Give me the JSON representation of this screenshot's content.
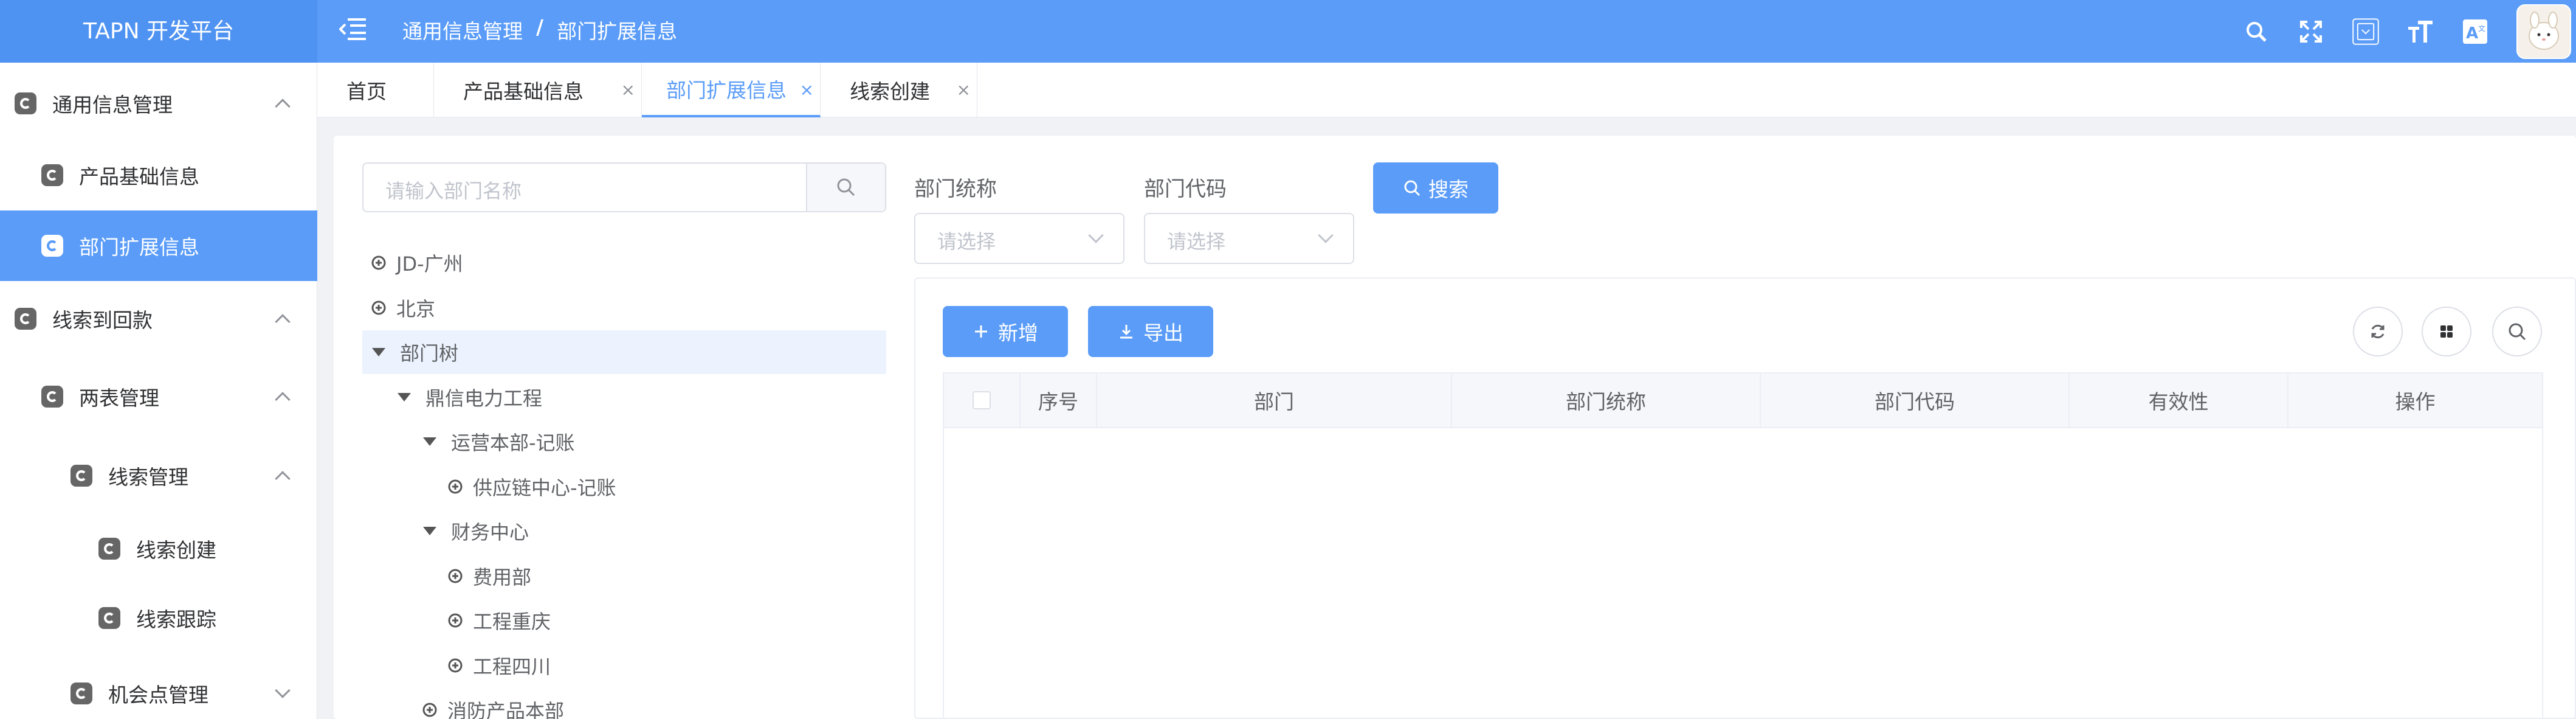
{
  "app": {
    "title": "TAPN 开发平台"
  },
  "breadcrumb": {
    "parent": "通用信息管理",
    "separator": "/",
    "current": "部门扩展信息"
  },
  "header_icons": [
    "search-icon",
    "fullscreen-icon",
    "dropdown-box-icon",
    "font-size-icon",
    "language-icon"
  ],
  "sidebar": {
    "items": [
      {
        "label": "通用信息管理",
        "level": 1,
        "expanded": true
      },
      {
        "label": "产品基础信息",
        "level": 2
      },
      {
        "label": "部门扩展信息",
        "level": 2,
        "active": true
      },
      {
        "label": "线索到回款",
        "level": 1,
        "expanded": true
      },
      {
        "label": "两表管理",
        "level": 2,
        "expanded": true
      },
      {
        "label": "线索管理",
        "level": 3,
        "expanded": true
      },
      {
        "label": "线索创建",
        "level": 4
      },
      {
        "label": "线索跟踪",
        "level": 4
      },
      {
        "label": "机会点管理",
        "level": 3,
        "expanded": false
      }
    ]
  },
  "tabs": [
    {
      "label": "首页",
      "closable": false
    },
    {
      "label": "产品基础信息",
      "closable": true,
      "close": "×"
    },
    {
      "label": "部门扩展信息",
      "closable": true,
      "close": "×",
      "active": true
    },
    {
      "label": "线索创建",
      "closable": true,
      "close": "×"
    }
  ],
  "tree": {
    "search_placeholder": "请输入部门名称",
    "nodes": [
      {
        "label": "JD-广州",
        "depth": 0,
        "state": "collapsed"
      },
      {
        "label": "北京",
        "depth": 0,
        "state": "collapsed"
      },
      {
        "label": "部门树",
        "depth": 0,
        "state": "expanded",
        "selected": true
      },
      {
        "label": "鼎信电力工程",
        "depth": 1,
        "state": "expanded"
      },
      {
        "label": "运营本部-记账",
        "depth": 2,
        "state": "expanded"
      },
      {
        "label": "供应链中心-记账",
        "depth": 3,
        "state": "collapsed"
      },
      {
        "label": "财务中心",
        "depth": 2,
        "state": "expanded"
      },
      {
        "label": "费用部",
        "depth": 3,
        "state": "collapsed"
      },
      {
        "label": "工程重庆",
        "depth": 3,
        "state": "collapsed"
      },
      {
        "label": "工程四川",
        "depth": 3,
        "state": "collapsed"
      },
      {
        "label": "消防产品本部",
        "depth": 2,
        "state": "collapsed"
      }
    ]
  },
  "filters": {
    "dept_alias": {
      "label": "部门统称",
      "placeholder": "请选择"
    },
    "dept_code": {
      "label": "部门代码",
      "placeholder": "请选择"
    },
    "search_label": "搜索"
  },
  "toolbar": {
    "add_label": "新增",
    "export_label": "导出"
  },
  "table": {
    "columns": [
      "",
      "序号",
      "部门",
      "部门统称",
      "部门代码",
      "有效性",
      "操作"
    ],
    "rows": []
  },
  "colors": {
    "primary": "#5a9cf8",
    "header_bg": "#5a9cf8",
    "active_menu": "#5a9cf8"
  }
}
